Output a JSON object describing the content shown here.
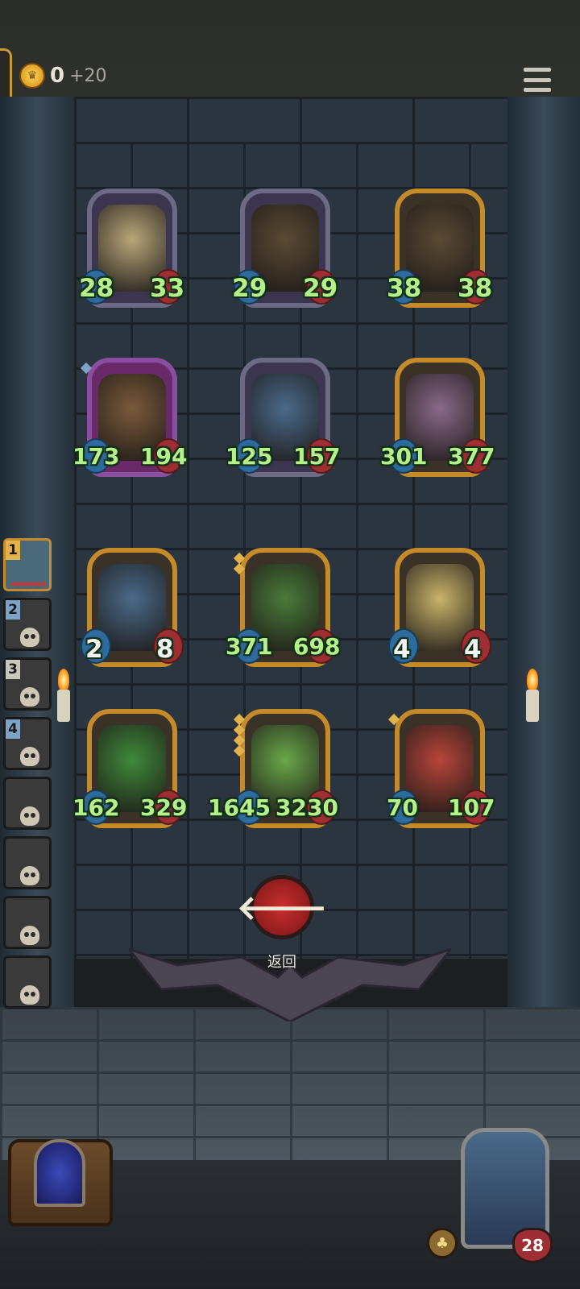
{
  "hud": {
    "gold_value": "0",
    "gold_bonus": "+20"
  },
  "board": {
    "rows": [
      [
        {
          "atk": "28",
          "hp": "33",
          "frame": "silver",
          "art": "mushroom-spider-icon",
          "color": "#b9a77a"
        },
        {
          "atk": "29",
          "hp": "29",
          "frame": "silver",
          "art": "treant-icon",
          "color": "#5a4a35"
        },
        {
          "atk": "38",
          "hp": "38",
          "frame": "gold",
          "art": "treant-icon",
          "color": "#5a4a35"
        }
      ],
      [
        {
          "atk": "173",
          "hp": "194",
          "frame": "purple",
          "art": "wooden-totem-icon",
          "color": "#7a5a3a"
        },
        {
          "atk": "125",
          "hp": "157",
          "frame": "silver",
          "art": "elf-sorceress-icon",
          "color": "#4a6a8a"
        },
        {
          "atk": "301",
          "hp": "377",
          "frame": "gold",
          "art": "purple-mushroom-icon",
          "color": "#8a6a8a"
        }
      ],
      [
        {
          "atk": "2",
          "hp": "8",
          "frame": "gold",
          "art": "elf-sorceress-icon",
          "color": "#4a6a8a"
        },
        {
          "atk": "371",
          "hp": "698",
          "frame": "gold",
          "art": "moss-creature-icon",
          "color": "#4a7a3a"
        },
        {
          "atk": "4",
          "hp": "4",
          "frame": "gold",
          "art": "fairy-icon",
          "color": "#c9b46a"
        }
      ],
      [
        {
          "atk": "162",
          "hp": "329",
          "frame": "gold",
          "art": "dryad-icon",
          "color": "#3f8a3a"
        },
        {
          "atk": "1645",
          "hp": "3230",
          "frame": "gold",
          "art": "leaf-sprite-icon",
          "color": "#6aa84a"
        },
        {
          "atk": "70",
          "hp": "107",
          "frame": "gold",
          "art": "red-imp-icon",
          "color": "#b8453a"
        }
      ]
    ]
  },
  "sidebar": {
    "slots": [
      {
        "badge": "1",
        "badge_color": "gold",
        "active": true
      },
      {
        "badge": "2",
        "badge_color": "blue",
        "active": false
      },
      {
        "badge": "3",
        "badge_color": "silver",
        "active": false
      },
      {
        "badge": "4",
        "badge_color": "blue",
        "active": false
      },
      {
        "badge": "",
        "badge_color": "",
        "active": false
      },
      {
        "badge": "",
        "badge_color": "",
        "active": false
      },
      {
        "badge": "",
        "badge_color": "",
        "active": false
      },
      {
        "badge": "",
        "badge_color": "",
        "active": false
      }
    ]
  },
  "back_button": {
    "label": "返回",
    "icon": "arrow-left-icon"
  },
  "hero": {
    "hp": "28"
  },
  "colors": {
    "gold_frame": "#c58a2a",
    "silver_frame": "#6d6a86",
    "purple_frame": "#8a4fa0",
    "stat_text": "#b5f08a",
    "back_button": "#c92e2e"
  }
}
